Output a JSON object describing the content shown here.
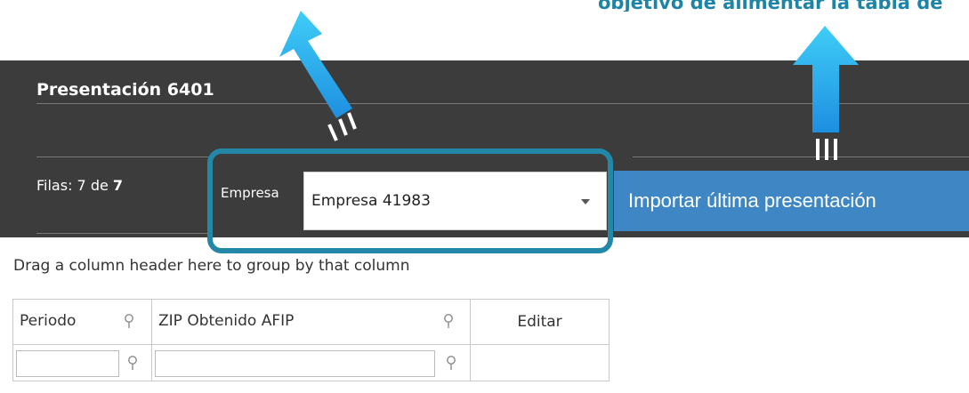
{
  "caption": "objetivo de alimentar la tabla de",
  "panel": {
    "title": "Presentación 6401",
    "rows_prefix": "Filas: 7 de",
    "rows_total": "7",
    "empresa_label": "Empresa",
    "empresa_value": "Empresa 41983",
    "import_button": "Importar última presentación"
  },
  "grid": {
    "group_hint": "Drag a column header here to group by that column",
    "columns": [
      "Periodo",
      "ZIP Obtenido AFIP",
      "Editar"
    ]
  },
  "colors": {
    "accent": "#2387a8",
    "button": "#3e87c4",
    "panel_bg": "#3c3c3c",
    "arrow": "#2db4ef"
  },
  "icons": [
    "arrow-up-icon",
    "pin-icon",
    "chevron-down-icon"
  ]
}
